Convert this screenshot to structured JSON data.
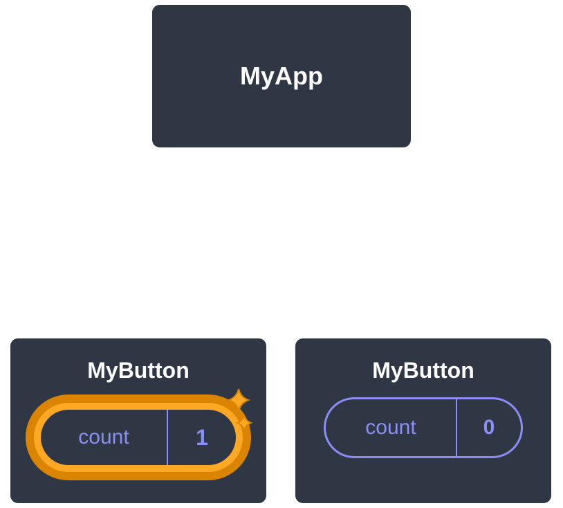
{
  "root": {
    "label": "MyApp"
  },
  "children": [
    {
      "label": "MyButton",
      "highlighted": true,
      "state": {
        "name": "count",
        "value": "1"
      }
    },
    {
      "label": "MyButton",
      "highlighted": false,
      "state": {
        "name": "count",
        "value": "0"
      }
    }
  ],
  "colors": {
    "node_bg": "#2f3745",
    "node_border": "#ffffff",
    "pill_border": "#8b8ff5",
    "pill_text": "#8b8ff5",
    "highlight_outer": "#db8400",
    "highlight_inner": "#ffa825"
  }
}
